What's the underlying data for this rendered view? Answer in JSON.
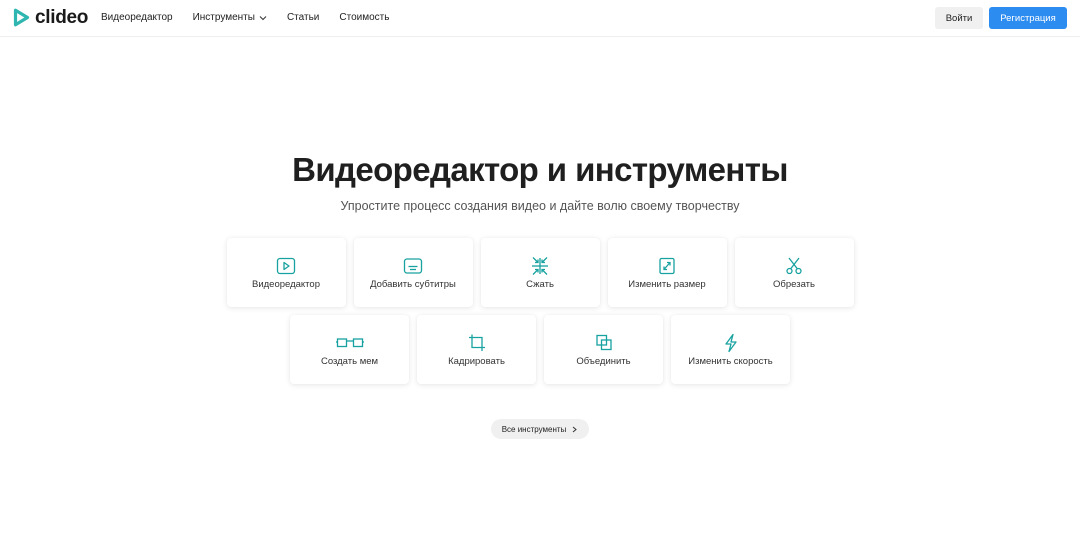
{
  "header": {
    "logo_text": "clideo",
    "logo_color": "#2fb6b0",
    "nav": [
      {
        "label": "Видеоредактор"
      },
      {
        "label": "Инструменты",
        "has_dropdown": true
      },
      {
        "label": "Статьи"
      },
      {
        "label": "Стоимость"
      }
    ],
    "login_label": "Войти",
    "register_label": "Регистрация",
    "register_color": "#2d8cf0"
  },
  "hero": {
    "title": "Видеоредактор и инструменты",
    "subtitle": "Упростите процесс создания видео и дайте волю своему творчеству"
  },
  "tools": {
    "accent_color": "#17a2a0",
    "row1": [
      {
        "label": "Видеоредактор",
        "icon": "play-icon"
      },
      {
        "label": "Добавить субтитры",
        "icon": "subtitles-icon"
      },
      {
        "label": "Сжать",
        "icon": "compress-icon"
      },
      {
        "label": "Изменить размер",
        "icon": "resize-icon"
      },
      {
        "label": "Обрезать",
        "icon": "scissors-icon"
      }
    ],
    "row2": [
      {
        "label": "Создать мем",
        "icon": "meme-icon"
      },
      {
        "label": "Кадрировать",
        "icon": "crop-icon"
      },
      {
        "label": "Объединить",
        "icon": "merge-icon"
      },
      {
        "label": "Изменить скорость",
        "icon": "lightning-icon"
      }
    ]
  },
  "all_tools_label": "Все инструменты"
}
